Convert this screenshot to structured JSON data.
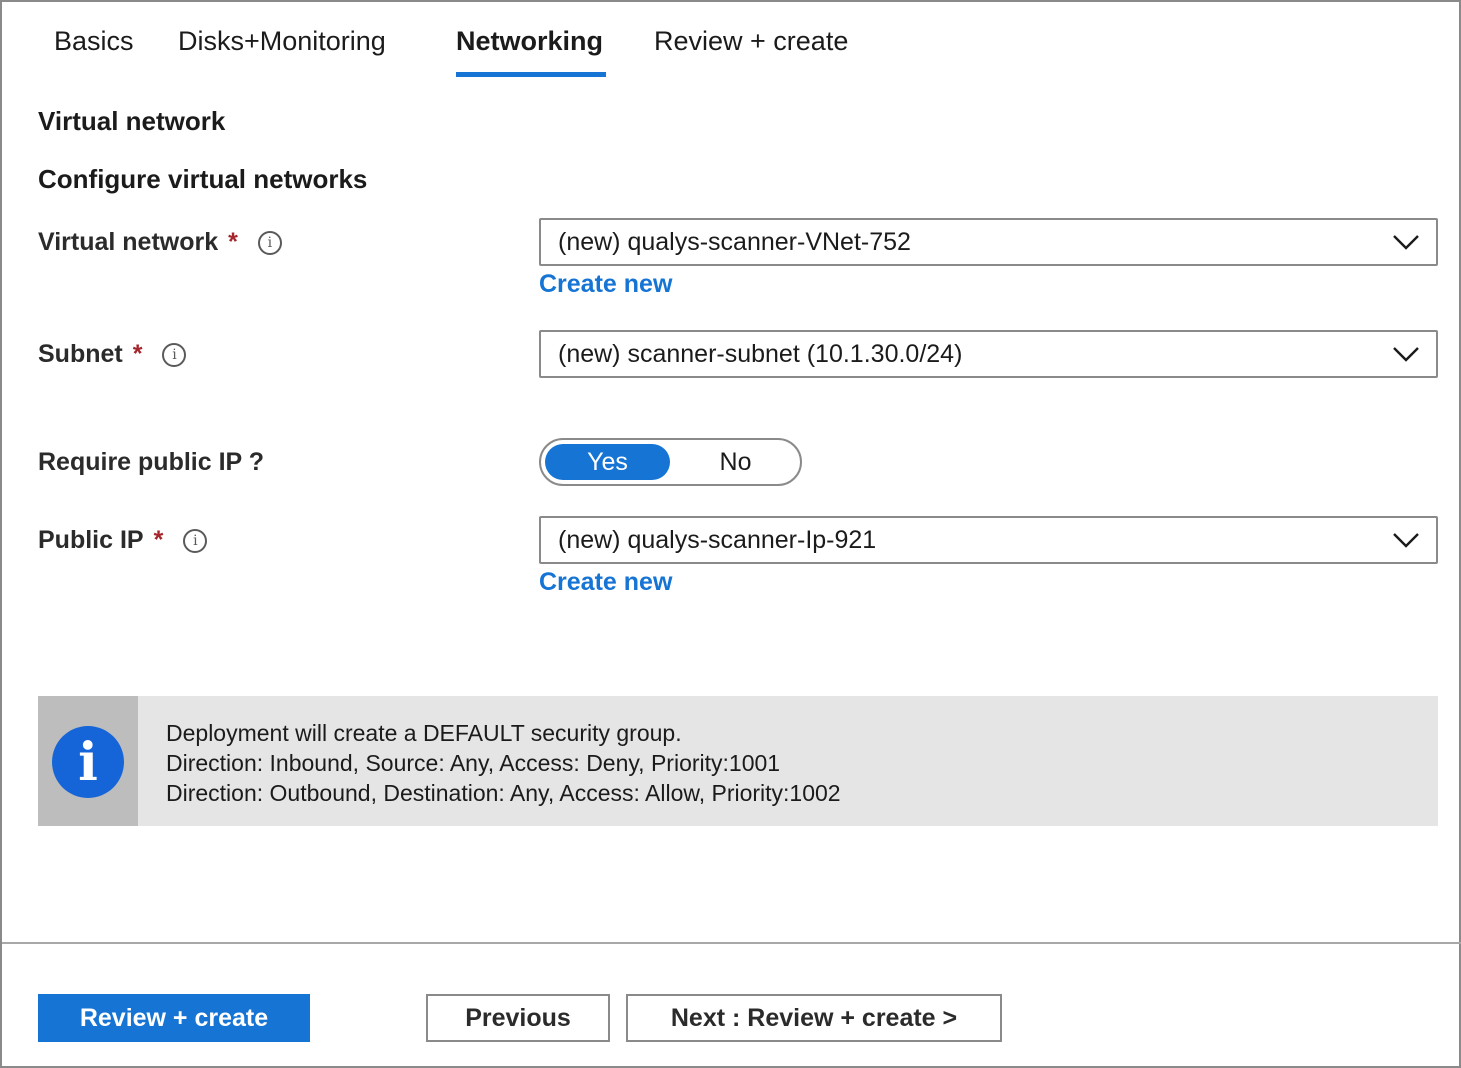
{
  "tabs": [
    {
      "label": "Basics",
      "active": false
    },
    {
      "label": "Disks+Monitoring",
      "active": false
    },
    {
      "label": "Networking",
      "active": true
    },
    {
      "label": "Review + create",
      "active": false
    }
  ],
  "section": {
    "title": "Virtual network",
    "subtitle": "Configure virtual networks"
  },
  "fields": {
    "virtual_network": {
      "label": "Virtual network",
      "required_mark": "*",
      "value": "(new) qualys-scanner-VNet-752",
      "create_link": "Create new"
    },
    "subnet": {
      "label": "Subnet",
      "required_mark": "*",
      "value": "(new) scanner-subnet (10.1.30.0/24)"
    },
    "require_public_ip": {
      "label": "Require public IP ?",
      "options": [
        "Yes",
        "No"
      ],
      "selected": "Yes"
    },
    "public_ip": {
      "label": "Public IP",
      "required_mark": "*",
      "value": "(new) qualys-scanner-Ip-921",
      "create_link": "Create new"
    }
  },
  "info_box": {
    "icon": "info-icon",
    "lines": [
      "Deployment will create a DEFAULT security group.",
      "Direction: Inbound, Source: Any, Access: Deny, Priority:1001",
      "Direction: Outbound, Destination: Any, Access: Allow, Priority:1002"
    ]
  },
  "footer": {
    "review_create": "Review + create",
    "previous": "Previous",
    "next": "Next : Review + create >"
  },
  "colors": {
    "accent": "#1574d4",
    "required": "#a4262c",
    "info_circle": "#1565d8",
    "info_bg": "#e5e5e5"
  }
}
